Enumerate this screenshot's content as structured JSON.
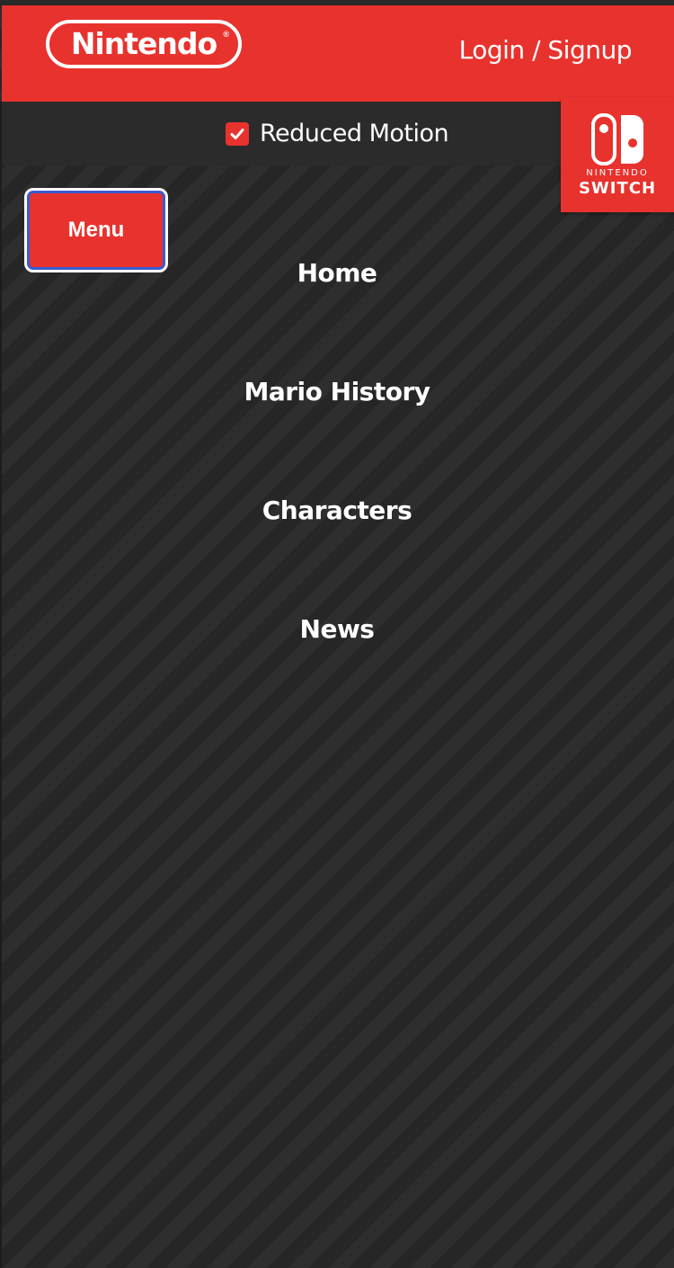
{
  "header": {
    "logo_text": "Nintendo",
    "logo_registered": "®",
    "login_label": "Login / Signup"
  },
  "reduced_motion": {
    "label": "Reduced Motion",
    "checked": true
  },
  "switch_badge": {
    "small_text": "NINTENDO",
    "big_text": "SWITCH"
  },
  "menu_button": {
    "label": "Menu"
  },
  "nav": {
    "items": [
      {
        "label": "Home"
      },
      {
        "label": "Mario History"
      },
      {
        "label": "Characters"
      },
      {
        "label": "News"
      }
    ]
  },
  "colors": {
    "brand_red": "#e8322d",
    "background": "#2a2a2a",
    "focus_ring": "#3a5bd0"
  }
}
